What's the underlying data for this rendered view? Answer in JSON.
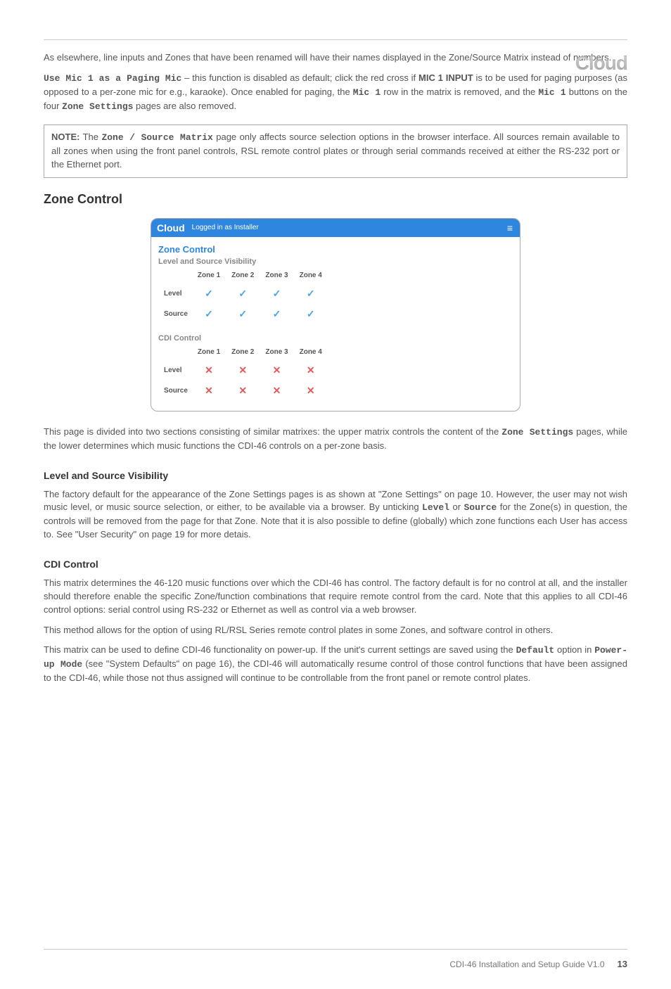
{
  "page_logo": "Cloud",
  "para1": "As elsewhere, line inputs and Zones that have been renamed will have their names displayed in the Zone/Source Matrix instead of numbers.",
  "para2_lead_mono": "Use Mic 1 as a Paging Mic",
  "para2_mid1": " – this function is disabled as default; click the red cross if ",
  "para2_bold": "MIC 1 INPUT",
  "para2_mid2": " is to be used for paging purposes (as opposed to a per-zone mic for e.g., karaoke). Once enabled for paging, the ",
  "para2_mono2": "Mic 1",
  "para2_mid3": " row in the matrix is removed, and the ",
  "para2_mono3": "Mic 1",
  "para2_mid4": " buttons on the four ",
  "para2_mono4": "Zone Settings",
  "para2_end": " pages are also removed.",
  "note_label": "NOTE:",
  "note_mid1": " The ",
  "note_mono": "Zone / Source Matrix",
  "note_text": " page only affects source selection options in the browser interface. All sources remain available to all zones when using the front panel controls, RSL remote control plates or through serial commands received at either the RS-232 port or the Ethernet port.",
  "h2_zone_control": "Zone Control",
  "screenshot": {
    "logo": "Cloud",
    "logged_in": "Logged in as Installer",
    "hamburger": "≡",
    "title": "Zone Control",
    "sub1": "Level and Source Visibility",
    "cols": [
      "Zone 1",
      "Zone 2",
      "Zone 3",
      "Zone 4"
    ],
    "rows_vis": [
      {
        "label": "Level",
        "vals": [
          "✓",
          "✓",
          "✓",
          "✓"
        ]
      },
      {
        "label": "Source",
        "vals": [
          "✓",
          "✓",
          "✓",
          "✓"
        ]
      }
    ],
    "sub2": "CDI Control",
    "rows_cdi": [
      {
        "label": "Level",
        "vals": [
          "✕",
          "✕",
          "✕",
          "✕"
        ]
      },
      {
        "label": "Source",
        "vals": [
          "✕",
          "✕",
          "✕",
          "✕"
        ]
      }
    ]
  },
  "para_after_ss_1": "This page is divided into two sections consisting of similar matrixes: the upper matrix controls the content of the ",
  "para_after_ss_mono": "Zone Settings",
  "para_after_ss_2": " pages, while the lower determines which music functions the CDI-46 controls on a per-zone basis.",
  "h3_vis": "Level and Source Visibility",
  "vis_para_1": "The factory default for the appearance of the Zone Settings pages is as shown at \"Zone Settings\" on page 10. However, the user may not wish music level, or music source selection, or either, to be available via a browser. By unticking ",
  "vis_mono1": "Level",
  "vis_mid": " or ",
  "vis_mono2": "Source",
  "vis_para_2": " for the Zone(s) in question, the controls will be removed from the page for that Zone. Note that it is also possible to define (globally) which zone functions each User has access to. See \"User Security\" on page 19 for more detais.",
  "h3_cdi": "CDI Control",
  "cdi_para1": "This matrix determines the 46-120 music functions over which the CDI-46 has control. The factory default is for no control at all, and the installer should therefore enable the specific Zone/function combinations that require remote control from the card. Note that this applies to all CDI-46 control options: serial control using RS-232 or Ethernet as well as control via a web browser.",
  "cdi_para2": "This method allows for the option of using RL/RSL Series remote control plates in some Zones, and software control in others.",
  "cdi_para3_1": "This matrix can be used to define CDI-46 functionality on power-up. If the unit's current settings are saved using the ",
  "cdi_mono1": "Default",
  "cdi_para3_2": " option in ",
  "cdi_mono2": "Power-up Mode",
  "cdi_para3_3": " (see \"System Defaults\" on page 16), the CDI-46 will automatically resume control of those control functions that have been assigned to the CDI-46, while those not thus assigned will continue to be controllable from the front panel or remote control plates.",
  "footer_text": "CDI-46 Installation and Setup Guide V1.0",
  "footer_page": "13"
}
